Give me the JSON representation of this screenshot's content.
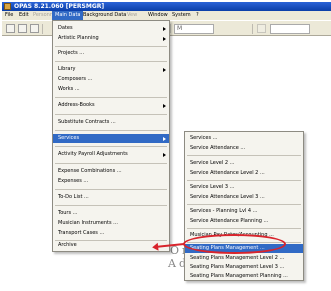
{
  "window": {
    "title": "OPAS 8.21.060 [PERSMGR]"
  },
  "menubar": {
    "items": [
      {
        "label": "File",
        "state": "normal"
      },
      {
        "label": "Edit",
        "state": "normal"
      },
      {
        "label": "Personn",
        "state": "disabled"
      },
      {
        "label": "Main Data",
        "state": "active"
      },
      {
        "label": "Background Data",
        "state": "normal"
      },
      {
        "label": "Vew",
        "state": "disabled"
      },
      {
        "label": "Window",
        "state": "normal"
      },
      {
        "label": "System",
        "state": "normal"
      },
      {
        "label": "?",
        "state": "normal"
      }
    ]
  },
  "toolbar": {
    "field_value": "M"
  },
  "main_menu": {
    "items": [
      {
        "label": "Dates"
      },
      {
        "label": "Artistic Planning"
      },
      {
        "label": "Projects ..."
      },
      {
        "label": "Library"
      },
      {
        "label": "Composers ..."
      },
      {
        "label": "Works ..."
      },
      {
        "label": "Address-Books"
      },
      {
        "label": "Substitute Contracts ..."
      },
      {
        "label": "Services"
      },
      {
        "label": "Activity Payroll Adjustments"
      },
      {
        "label": "Expense Combinations ..."
      },
      {
        "label": "Expenses ..."
      },
      {
        "label": "To-Do List ..."
      },
      {
        "label": "Tours ..."
      },
      {
        "label": "Musician Instruments ..."
      },
      {
        "label": "Transport Cases ..."
      },
      {
        "label": "Archive"
      }
    ]
  },
  "services_menu": {
    "items": [
      {
        "label": "Services ..."
      },
      {
        "label": "Service Attendance ..."
      },
      {
        "label": "Service Level 2 ..."
      },
      {
        "label": "Service Attendance Level 2 ..."
      },
      {
        "label": "Service Level 3 ..."
      },
      {
        "label": "Service Attendance Level 3 ..."
      },
      {
        "label": "Services - Planning Lvl 4 ..."
      },
      {
        "label": "Service Attendance Planning ..."
      },
      {
        "label": "Musician Pay Rates/Accounting ..."
      },
      {
        "label": "Seating Plans Management ..."
      },
      {
        "label": "Seating Plans Management Level 2 ..."
      },
      {
        "label": "Seating Plans Management Level 3 ..."
      },
      {
        "label": "Seating Plans Management Planning ..."
      }
    ]
  },
  "background_logo": {
    "line1": "Orc",
    "line2": "Adm"
  },
  "colors": {
    "menu_highlight": "#316ac5",
    "annotation": "#d8242c",
    "titlebar": "#0a3ea8"
  }
}
